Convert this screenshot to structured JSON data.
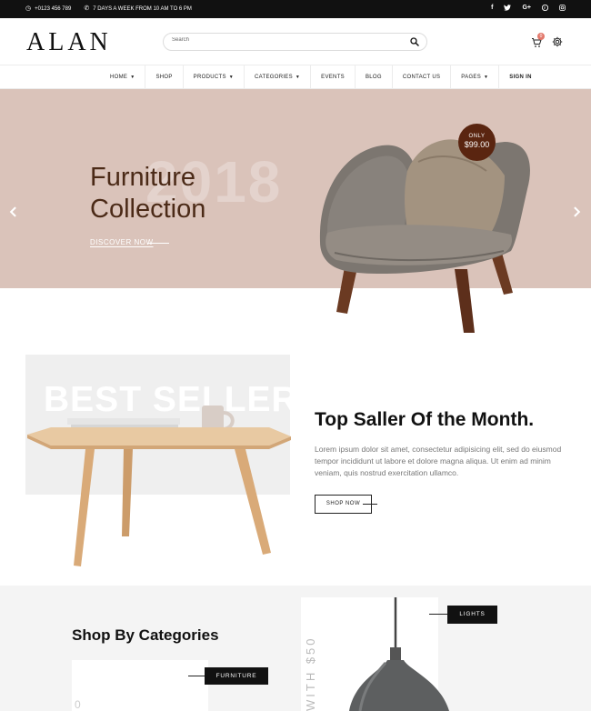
{
  "topbar": {
    "phone": "+0123 456 789",
    "hours": "7 DAYS A WEEK FROM 10 AM TO 6 PM",
    "social": [
      "f",
      "t",
      "G+",
      "p",
      "ig"
    ]
  },
  "header": {
    "logo": "ALAN",
    "search_placeholder": "Search",
    "cart_count": "0"
  },
  "nav": {
    "items": [
      {
        "label": "HOME",
        "caret": "▼"
      },
      {
        "label": "SHOP"
      },
      {
        "label": "PRODUCTS",
        "caret": "▼"
      },
      {
        "label": "CATEGORIES",
        "caret": "▼"
      },
      {
        "label": "EVENTS"
      },
      {
        "label": "BLOG"
      },
      {
        "label": "CONTACT US"
      },
      {
        "label": "PAGES",
        "caret": "▼"
      },
      {
        "label": "SIGN IN"
      }
    ]
  },
  "hero": {
    "ghost_year": "2018",
    "title_line1": "Furniture",
    "title_line2": "Collection",
    "cta": "DISCOVER NOW",
    "badge_only": "ONLY",
    "badge_price": "$99.00",
    "bg_color": "#dac3ba"
  },
  "bestseller": {
    "ghost": "BEST SELLER",
    "title": "Top Saller Of the Month.",
    "description": "Lorem ipsum dolor sit amet, consectetur adipisicing elit, sed do eiusmod tempor incididunt ut labore et dolore magna aliqua. Ut enim ad minim veniam, quis nostrud exercitation ullamco.",
    "button": "SHOP NOW"
  },
  "categories": {
    "title": "Shop By Categories",
    "furniture_label": "FURNITURE",
    "lights_label": "LIGHTS",
    "vertical_text": "WITH $50",
    "card1_ghost": "0"
  }
}
